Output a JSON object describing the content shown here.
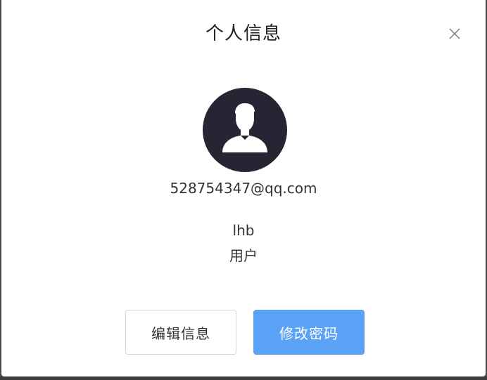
{
  "dialog": {
    "title": "个人信息",
    "close_icon": "close-icon"
  },
  "profile": {
    "avatar_icon": "user-avatar-icon",
    "email": "528754347@qq.com",
    "username": "lhb",
    "role": "用户"
  },
  "actions": {
    "edit_label": "编辑信息",
    "change_password_label": "修改密码"
  },
  "colors": {
    "primary": "#5aa2f5",
    "avatar_bg": "#262533",
    "text": "#333333"
  }
}
